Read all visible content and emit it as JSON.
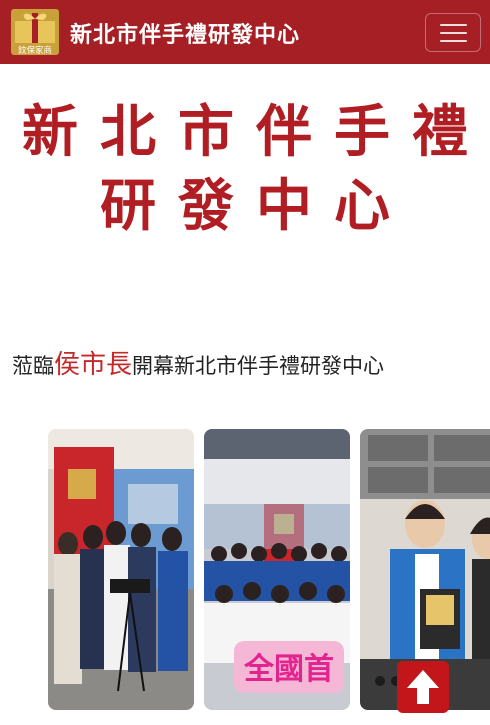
{
  "navbar": {
    "logo_caption": "鈫保家商",
    "brand_title": "新北市伴手禮研發中心",
    "menu_toggle_icon": "hamburger-icon"
  },
  "hero": {
    "title_line1": "新北市伴手禮",
    "title_line2": "研發中心"
  },
  "subtitle": {
    "prefix": "蒞臨",
    "highlight": "侯市長",
    "suffix": "開幕新北市伴手禮研發中心"
  },
  "gallery": {
    "photo2_banner": "全國首"
  },
  "colors": {
    "brand_red": "#a51f24",
    "title_red": "#b01e23",
    "highlight_red": "#c62828",
    "back_to_top_red": "#c2161b"
  },
  "back_to_top_icon": "arrow-up-icon"
}
